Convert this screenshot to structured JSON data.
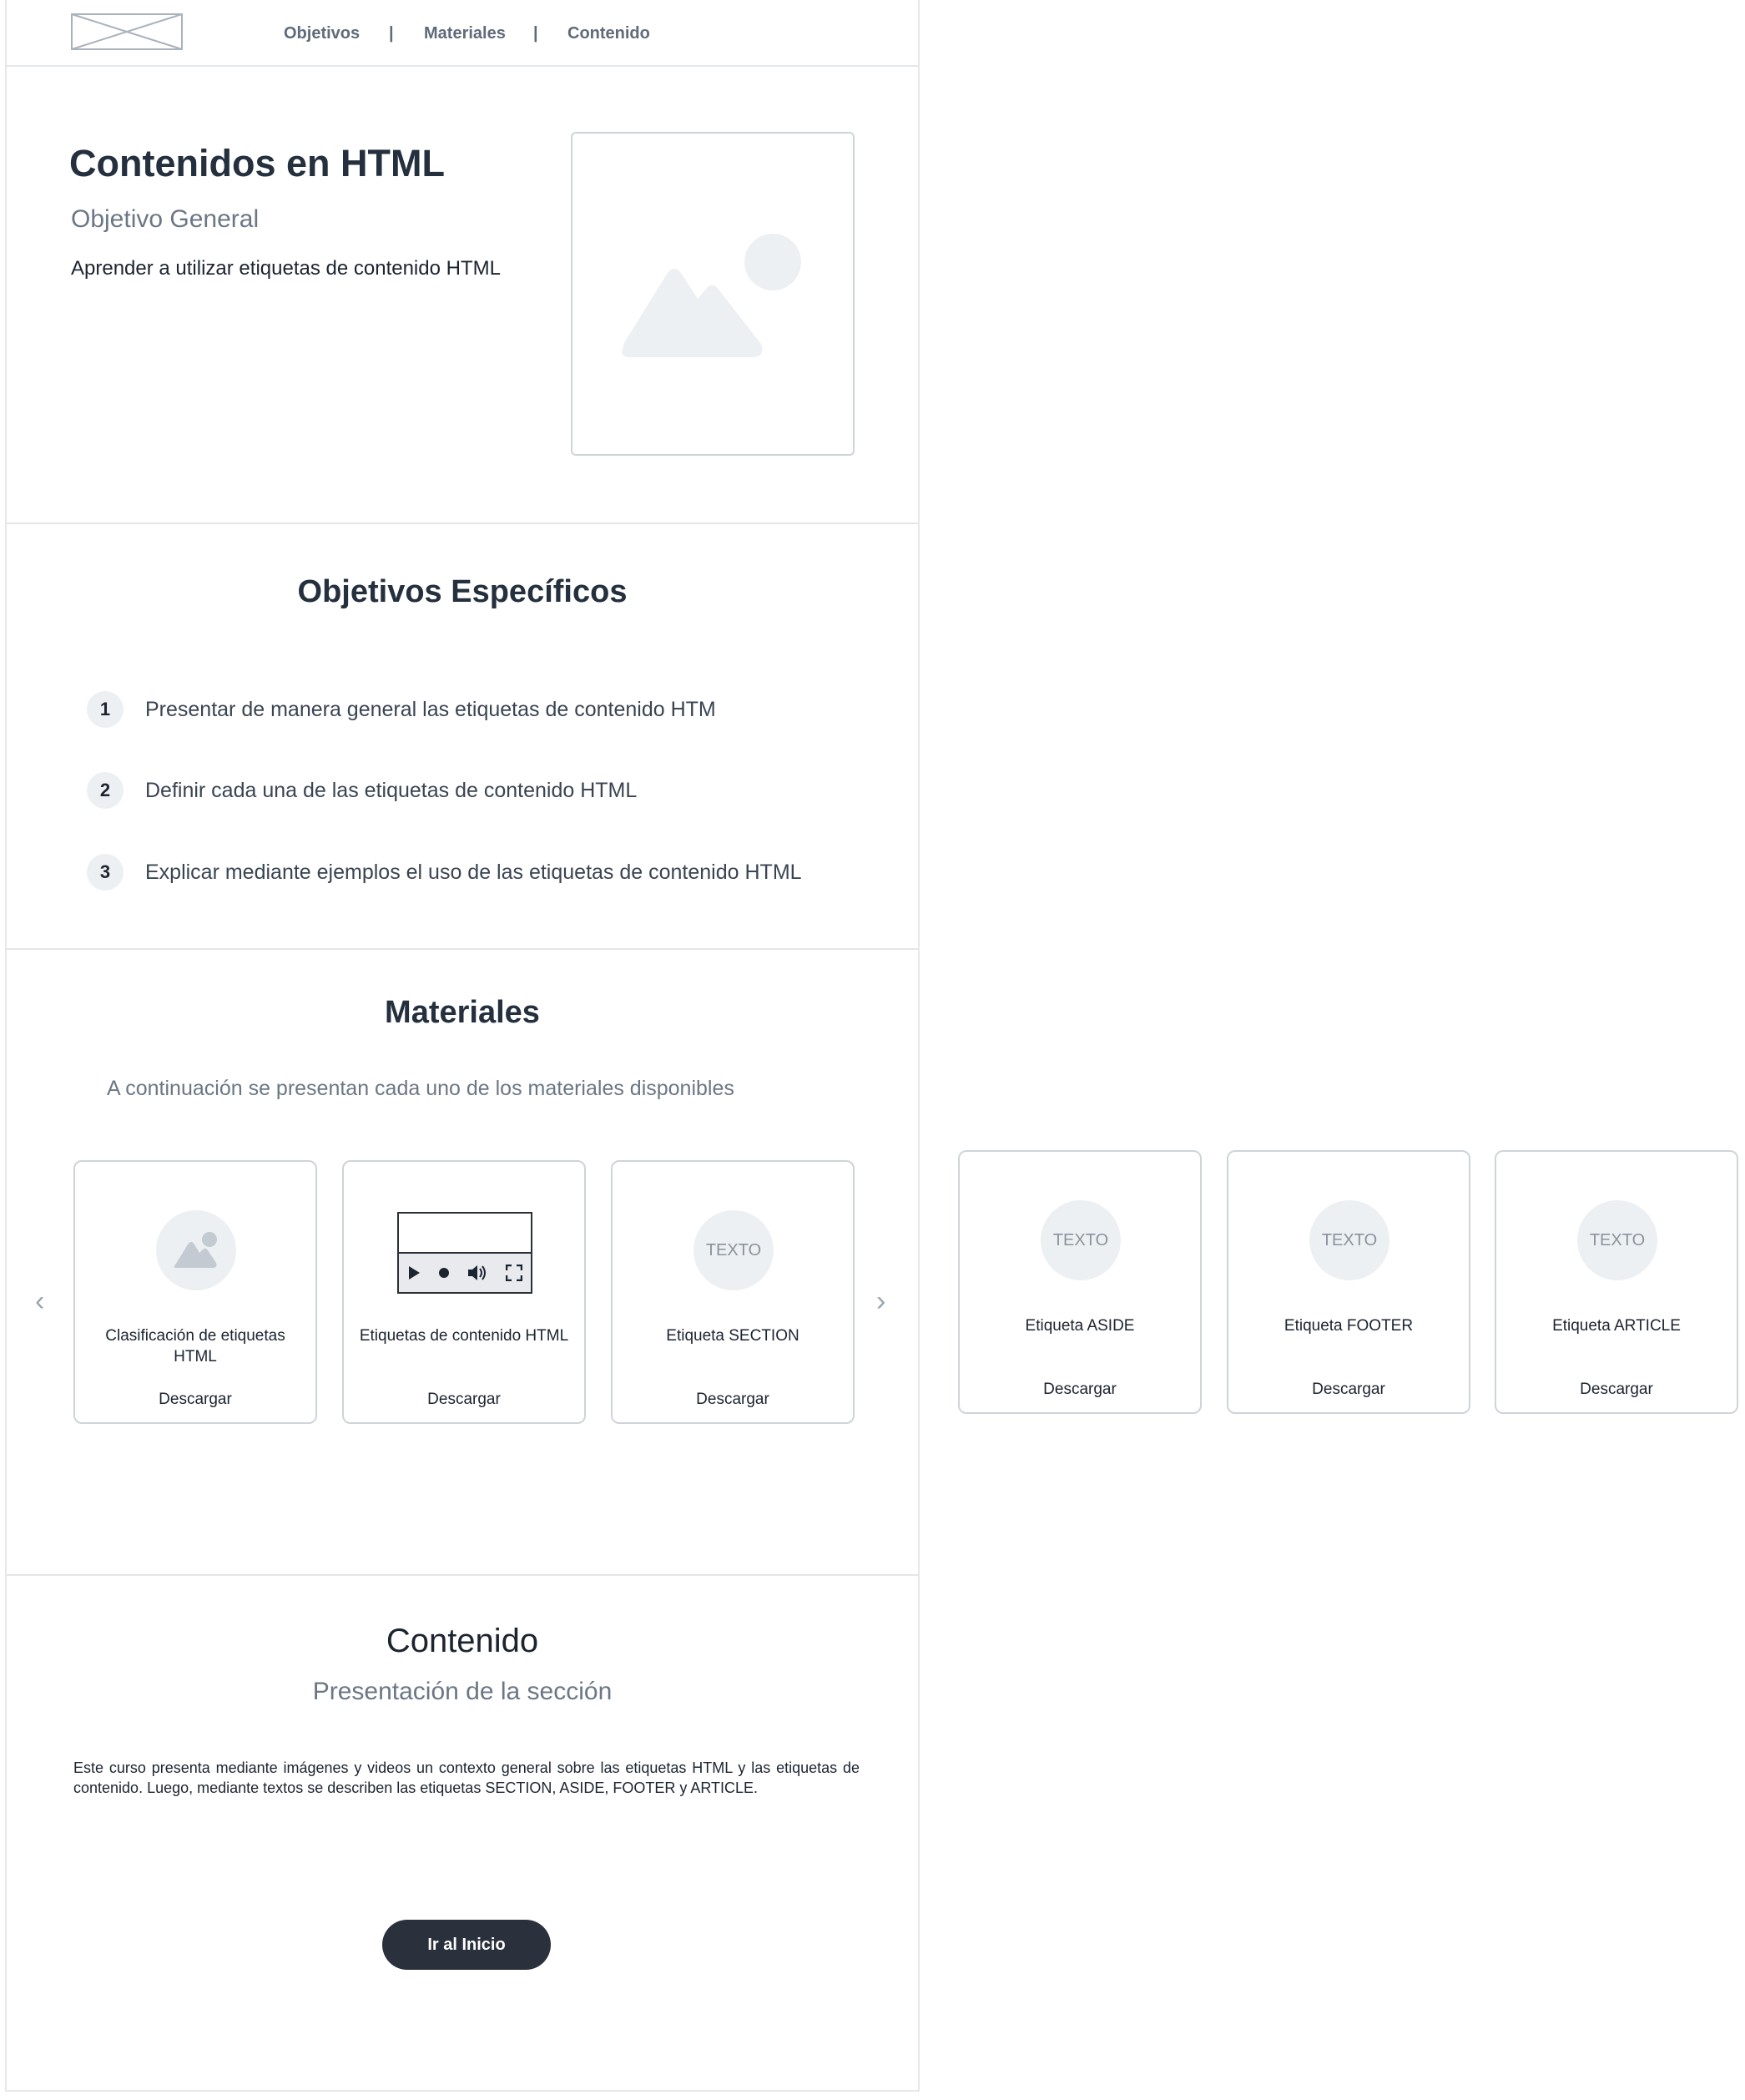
{
  "nav": {
    "items": [
      "Objetivos",
      "Materiales",
      "Contenido"
    ],
    "separator": "|"
  },
  "hero": {
    "title": "Contenidos en HTML",
    "subtitle": "Objetivo General",
    "description": "Aprender  a utilizar etiquetas de contenido HTML",
    "image_icon": "image-placeholder-icon"
  },
  "objetivos": {
    "title": "Objetivos Específicos",
    "items": [
      {
        "number": "1",
        "text": "Presentar de manera general las etiquetas de contenido HTM"
      },
      {
        "number": "2",
        "text": "Definir cada una de las etiquetas de contenido HTML"
      },
      {
        "number": "3",
        "text": "Explicar mediante ejemplos el uso de las etiquetas de contenido HTML"
      }
    ]
  },
  "materiales": {
    "title": "Materiales",
    "intro": "A continuación se presentan cada uno de los materiales disponibles",
    "prev_icon": "chevron-left-icon",
    "next_icon": "chevron-right-icon",
    "cards": [
      {
        "icon": "image-icon",
        "label": "Clasificación de etiquetas HTML",
        "download": "Descargar"
      },
      {
        "icon": "video-player-icon",
        "label": "Etiquetas de contenido HTML",
        "download": "Descargar"
      },
      {
        "icon_text": "TEXTO",
        "label": "Etiqueta SECTION",
        "download": "Descargar"
      }
    ],
    "extra_cards": [
      {
        "icon_text": "TEXTO",
        "label": "Etiqueta ASIDE",
        "download": "Descargar"
      },
      {
        "icon_text": "TEXTO",
        "label": "Etiqueta FOOTER",
        "download": "Descargar"
      },
      {
        "icon_text": "TEXTO",
        "label": "Etiqueta ARTICLE",
        "download": "Descargar"
      }
    ]
  },
  "contenido": {
    "title": "Contenido",
    "subtitle": "Presentación de la sección",
    "body": "Este curso presenta mediante imágenes y videos un contexto general sobre las etiquetas HTML y las etiquetas de contenido. Luego, mediante textos se describen las etiquetas SECTION, ASIDE, FOOTER y ARTICLE.",
    "button": "Ir al Inicio"
  },
  "colors": {
    "primary_dark": "#2a313c",
    "muted_text": "#6b7785",
    "placeholder": "#edf0f3",
    "border": "#cfd4da"
  }
}
